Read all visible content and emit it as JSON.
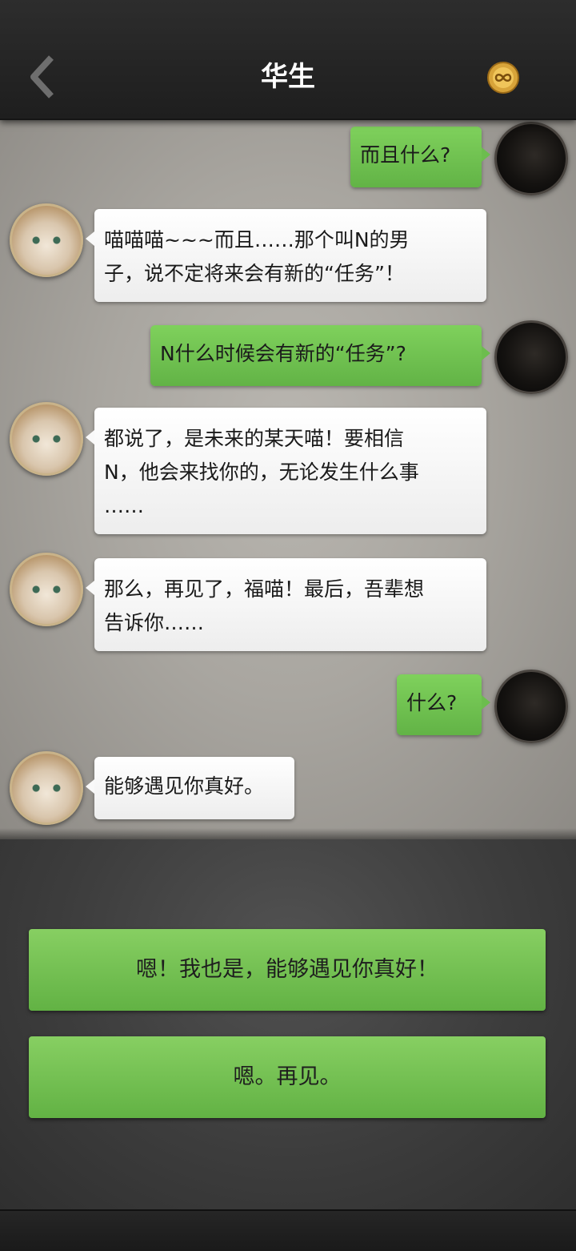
{
  "header": {
    "title": "华生",
    "back_icon": "chevron-left-icon",
    "coin_icon": "gold-coin-infinity-icon"
  },
  "messages": [
    {
      "side": "right",
      "text": "而且什么?"
    },
    {
      "side": "left",
      "lines": [
        "喵喵喵~~~而且……那个叫N的男",
        "子，说不定将来会有新的“任务”！"
      ]
    },
    {
      "side": "right",
      "text": "N什么时候会有新的“任务”?"
    },
    {
      "side": "left",
      "lines": [
        "都说了，是未来的某天喵！要相信",
        "N，他会来找你的，无论发生什么事",
        "……"
      ]
    },
    {
      "side": "left",
      "lines": [
        "那么，再见了，福喵！最后，吾辈想",
        "告诉你……"
      ]
    },
    {
      "side": "right",
      "text": "什么?"
    },
    {
      "side": "left",
      "lines": [
        "能够遇见你真好。"
      ]
    }
  ],
  "choices": [
    {
      "label": "嗯！我也是，能够遇见你真好！"
    },
    {
      "label": "嗯。再见。"
    }
  ],
  "colors": {
    "bubble_green": "#6cbd4e",
    "bubble_white": "#f9f9f9",
    "topbar": "#262626"
  }
}
